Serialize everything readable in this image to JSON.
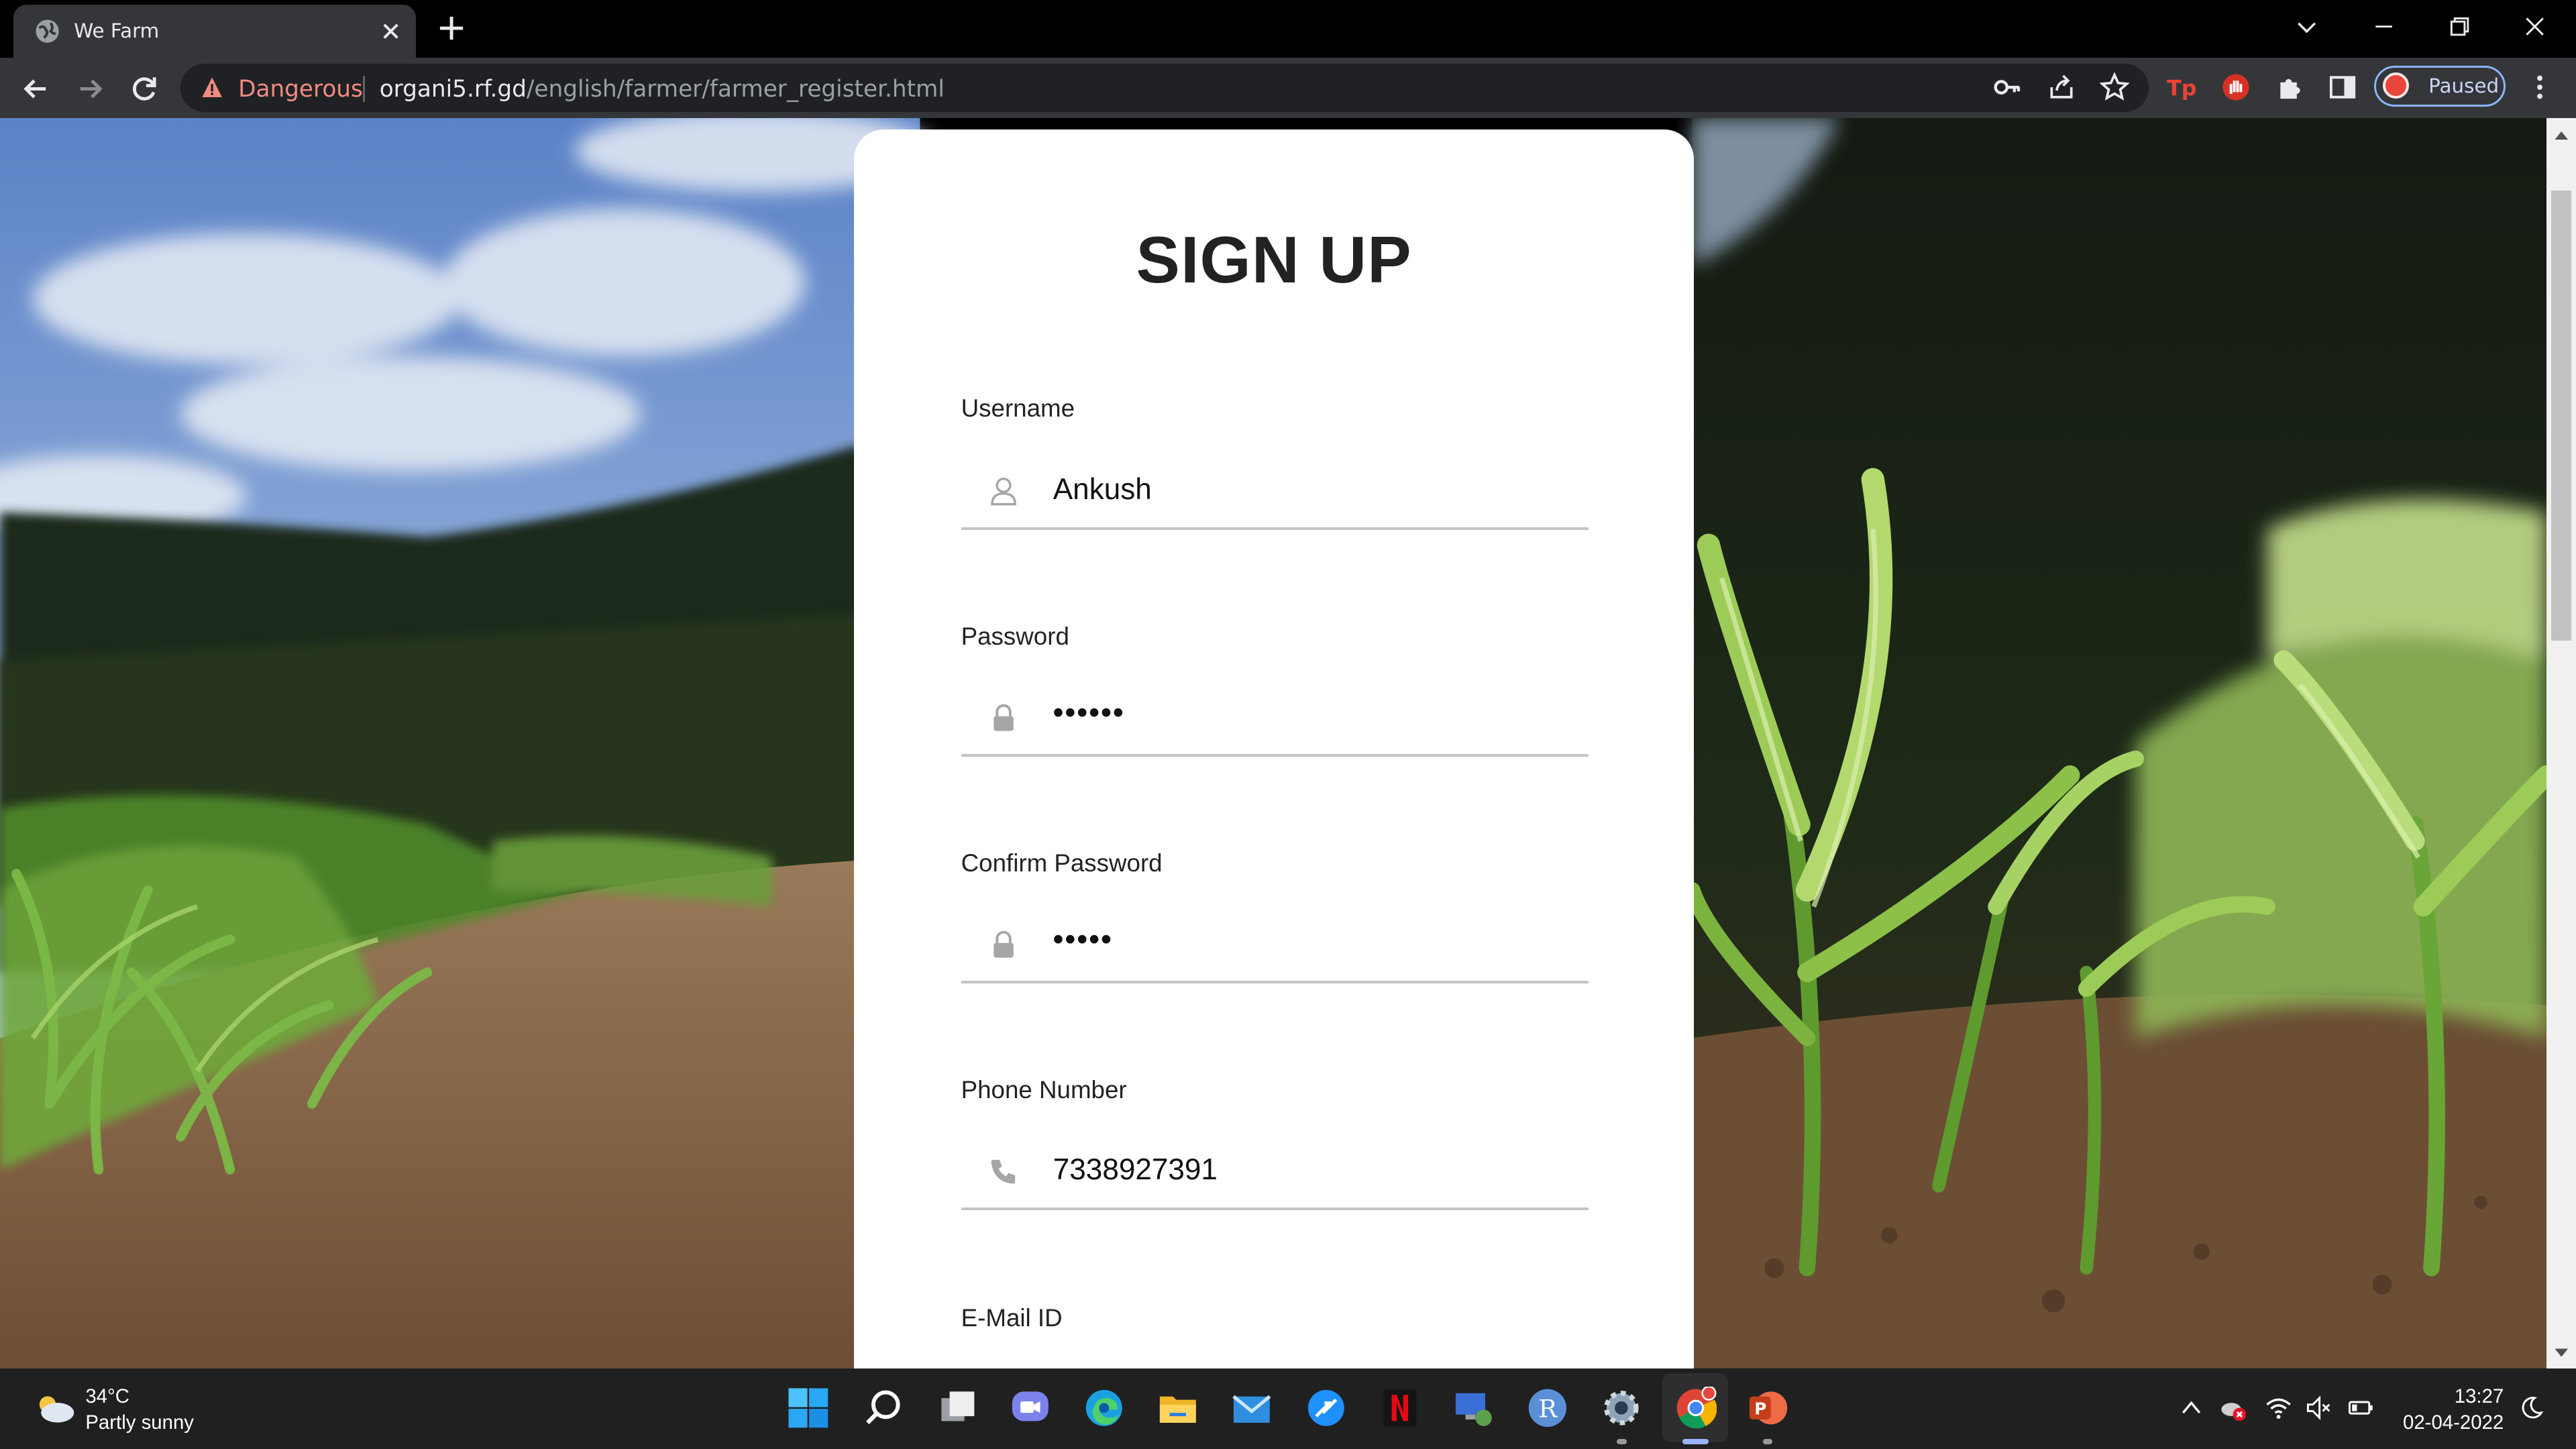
{
  "browser": {
    "tab": {
      "title": "We Farm",
      "favicon": "globe-icon"
    },
    "address": {
      "security_label": "Dangerous",
      "url_host": "organi5.rf.gd",
      "url_path": "/english/farmer/farmer_register.html"
    },
    "profile": {
      "label": "Paused"
    },
    "colors": {
      "frame": "#000000",
      "toolbar": "#35363a",
      "danger": "#f28b82"
    }
  },
  "form": {
    "title": "SIGN UP",
    "fields": [
      {
        "label": "Username",
        "value": "Ankush",
        "icon": "user-icon"
      },
      {
        "label": "Password",
        "value": "••••••",
        "icon": "lock-icon"
      },
      {
        "label": "Confirm Password",
        "value": "•••••",
        "icon": "lock-icon"
      },
      {
        "label": "Phone Number",
        "value": "7338927391",
        "icon": "phone-icon"
      },
      {
        "label": "E-Mail ID"
      }
    ]
  },
  "taskbar": {
    "weather": {
      "temp": "34°C",
      "desc": "Partly sunny"
    },
    "clock": {
      "time": "13:27",
      "date": "02-04-2022"
    },
    "apps": [
      "start-icon",
      "search-icon",
      "task-view-icon",
      "teams-chat-icon",
      "edge-icon",
      "file-explorer-icon",
      "mail-icon",
      "app-icon",
      "netflix-icon",
      "remote-app-icon",
      "r-app-icon",
      "settings-icon",
      "chrome-icon",
      "powerpoint-icon"
    ]
  }
}
